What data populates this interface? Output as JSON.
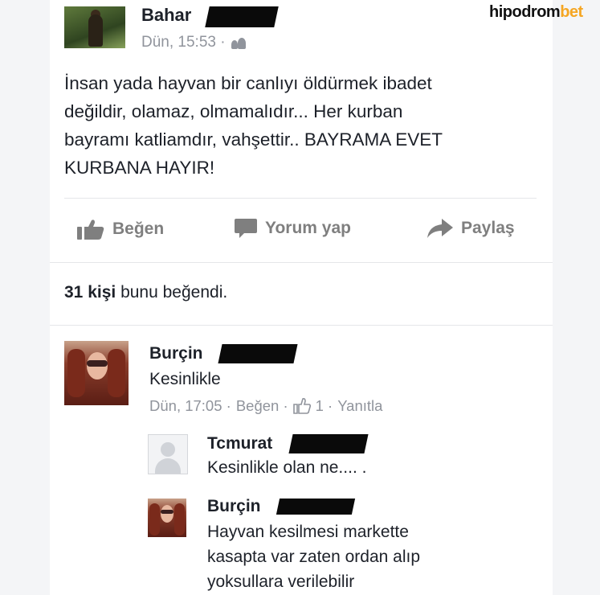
{
  "watermark": {
    "part1": "hipodrom",
    "part2": "bet"
  },
  "post": {
    "author": "Bahar",
    "timestamp": "Dün, 15:53 ·",
    "audience_icon": "friends-icon",
    "text_lines": [
      "İnsan yada hayvan bir canlıyı öldürmek ibadet",
      "değildir, olamaz, olmamalıdır... Her kurban",
      "bayramı katliamdır, vahşettir.. BAYRAMA EVET",
      "KURBANA HAYIR!"
    ]
  },
  "actions": {
    "like": "Beğen",
    "comment": "Yorum yap",
    "share": "Paylaş"
  },
  "likes": {
    "count": "31",
    "count_word": "kişi",
    "suffix": " bunu beğendi."
  },
  "comments": [
    {
      "author": "Burçin",
      "text": "Kesinlikle",
      "time": "Dün, 17:05 ·",
      "like_label": "Beğen ·",
      "like_count": "1 ·",
      "reply_label": "Yanıtla"
    }
  ],
  "replies": [
    {
      "author": "Tcmurat",
      "text": "Kesinlikle olan ne.... ."
    },
    {
      "author": "Burçin",
      "text_lines": [
        "Hayvan kesilmesi markette",
        "kasapta var zaten ordan alıp",
        "yoksullara verilebilir"
      ]
    }
  ],
  "colors": {
    "text": "#1d2129",
    "muted": "#90949c",
    "watermark_accent": "#f5a623"
  }
}
